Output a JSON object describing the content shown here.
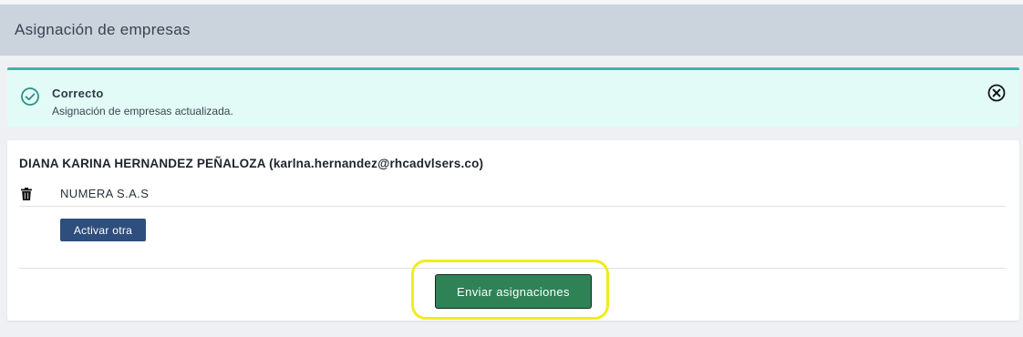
{
  "page": {
    "title": "Asignación de empresas"
  },
  "alert": {
    "title": "Correcto",
    "message": "Asignación de empresas actualizada.",
    "icon": "check-circle-icon",
    "close_icon": "close-circle-icon",
    "accent_color": "#3fb5a8",
    "background_color": "#e2fbf7"
  },
  "assignment": {
    "user_heading": "DIANA KARINA HERNANDEZ PEÑALOZA (karlna.hernandez@rhcadvlsers.co)",
    "companies": [
      {
        "name": "NUMERA S.A.S",
        "delete_icon": "trash-icon"
      }
    ],
    "activate_button_label": "Activar otra",
    "submit_button_label": "Enviar asignaciones"
  },
  "colors": {
    "header_bg": "#cbd3dd",
    "activate_button": "#2e4f7d",
    "submit_button": "#2f8256",
    "highlight": "#f0ec1c"
  }
}
